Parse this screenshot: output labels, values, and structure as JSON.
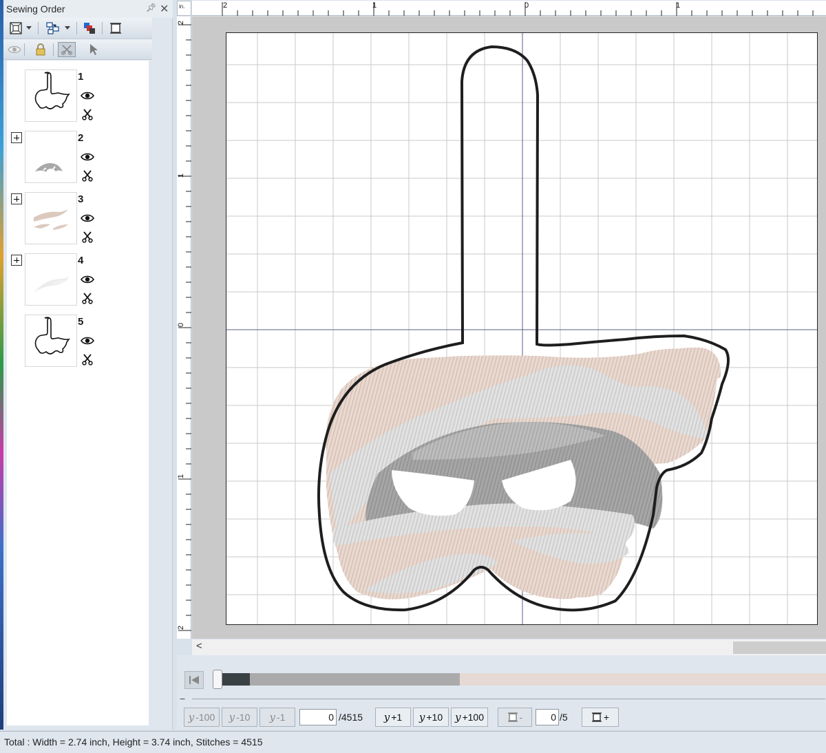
{
  "panel": {
    "title": "Sewing Order",
    "pin_icon": "pin-icon",
    "close_glyph": "✕"
  },
  "toolbar_top": [
    "fit-view-icon",
    "group-dropdown-icon",
    "color-order-icon",
    "frame-icon"
  ],
  "toolbar_bottom": [
    "eye-icon",
    "lock-icon",
    "scissors-toggle-icon",
    "select-pointer-icon"
  ],
  "items": [
    {
      "num": "1",
      "expandable": false
    },
    {
      "num": "2",
      "expandable": true
    },
    {
      "num": "3",
      "expandable": true
    },
    {
      "num": "4",
      "expandable": true
    },
    {
      "num": "5",
      "expandable": false
    }
  ],
  "ruler": {
    "unit": "in.",
    "h_labels": [
      "2",
      "1",
      "0",
      "1"
    ],
    "v_labels": [
      "2",
      "1",
      "0",
      "1",
      "2"
    ]
  },
  "colors": {
    "outline": "#1e1e1e",
    "bandage_beige": "#e6d4cb",
    "bandage_light_gray": "#d9d9d9",
    "bandage_mid_gray": "#bfbfbf",
    "shadow_gray": "#9e9e9e"
  },
  "scroll": {
    "left_arrow": "<"
  },
  "stitch_nav": {
    "first_button": "go-to-first-icon",
    "minus_symbol": "−",
    "back_buttons": [
      "-100",
      "-10",
      "-1"
    ],
    "current": "0",
    "total": "/4515",
    "forward_buttons": [
      "+1",
      "+10",
      "+100"
    ],
    "color_prev_label": "-",
    "color_current": "0",
    "color_total": "/5",
    "color_next_label": "+",
    "progress": 0.4
  },
  "status": {
    "text": "Total : Width = 2.74 inch, Height = 3.74 inch, Stitches = 4515"
  }
}
